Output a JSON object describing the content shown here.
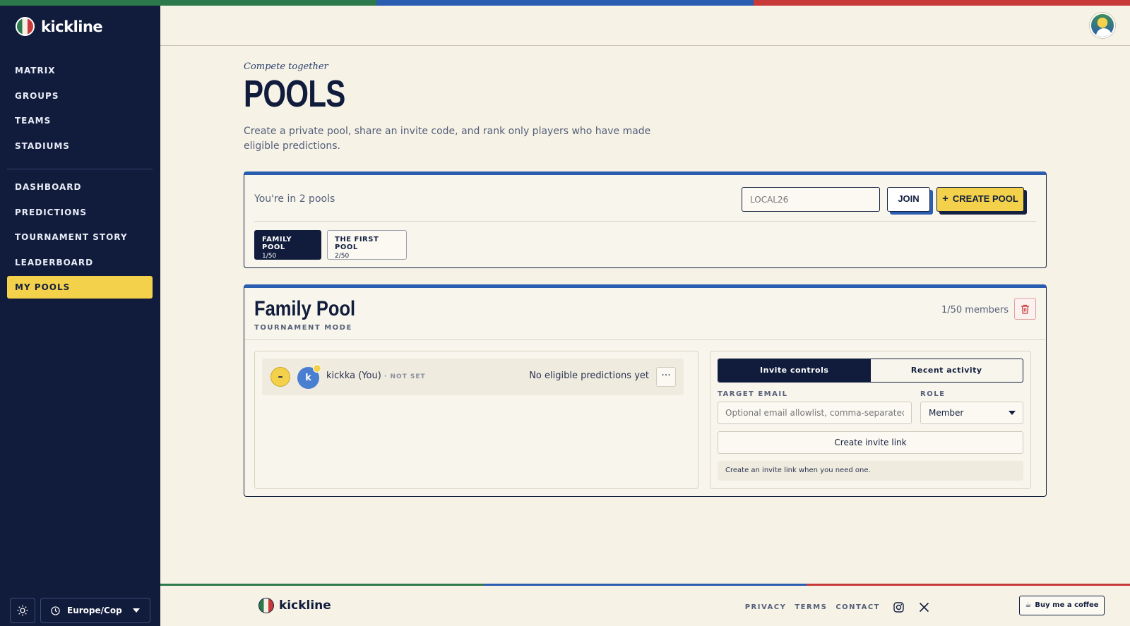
{
  "brand": {
    "name": "kickline",
    "colors": {
      "green": "#2c7a4b",
      "blue": "#2a5cb0",
      "red": "#c8393a",
      "navy": "#111c3c",
      "yellow": "#f4d14a"
    }
  },
  "sidebar": {
    "nav_primary": [
      {
        "label": "MATRIX"
      },
      {
        "label": "GROUPS"
      },
      {
        "label": "TEAMS"
      },
      {
        "label": "STADIUMS"
      }
    ],
    "nav_secondary": [
      {
        "label": "DASHBOARD"
      },
      {
        "label": "PREDICTIONS"
      },
      {
        "label": "TOURNAMENT STORY"
      },
      {
        "label": "LEADERBOARD"
      },
      {
        "label": "MY POOLS",
        "active": true
      }
    ],
    "theme_icon": "sun-icon",
    "timezone": {
      "icon": "clock-icon",
      "value": "Europe/Cop"
    }
  },
  "header": {
    "avatar_icon": "user-avatar"
  },
  "page": {
    "eyebrow": "Compete together",
    "title": "POOLS",
    "subtitle": "Create a private pool, share an invite code, and rank only players who have made eligible predictions."
  },
  "pools_bar": {
    "count_text": "You're in 2 pools",
    "code_placeholder": "LOCAL26",
    "join_label": "JOIN",
    "create_label": "CREATE POOL",
    "chips": [
      {
        "name": "FAMILY POOL",
        "count": "1/50",
        "active": true
      },
      {
        "name": "THE FIRST POOL",
        "count": "2/50",
        "active": false
      }
    ]
  },
  "pool": {
    "title": "Family Pool",
    "mode": "TOURNAMENT MODE",
    "members": "1/50 members",
    "member_list": [
      {
        "rank": "–",
        "initial": "k",
        "name": "kickka (You)",
        "separator": " · ",
        "status": "NOT SET",
        "note": "No eligible predictions yet",
        "more": "···"
      }
    ],
    "tabs": [
      {
        "label": "Invite controls",
        "active": true
      },
      {
        "label": "Recent activity",
        "active": false
      }
    ],
    "email_label": "TARGET EMAIL",
    "email_placeholder": "Optional email allowlist, comma-separated",
    "role_label": "ROLE",
    "role_value": "Member",
    "invite_button": "Create invite link",
    "hint": "Create an invite link when you need one."
  },
  "footer": {
    "brand": "kickline",
    "links": [
      {
        "label": "PRIVACY"
      },
      {
        "label": "TERMS"
      },
      {
        "label": "CONTACT"
      }
    ],
    "social": [
      "instagram-icon",
      "x-icon"
    ],
    "coffee_label": "Buy me a coffee"
  }
}
